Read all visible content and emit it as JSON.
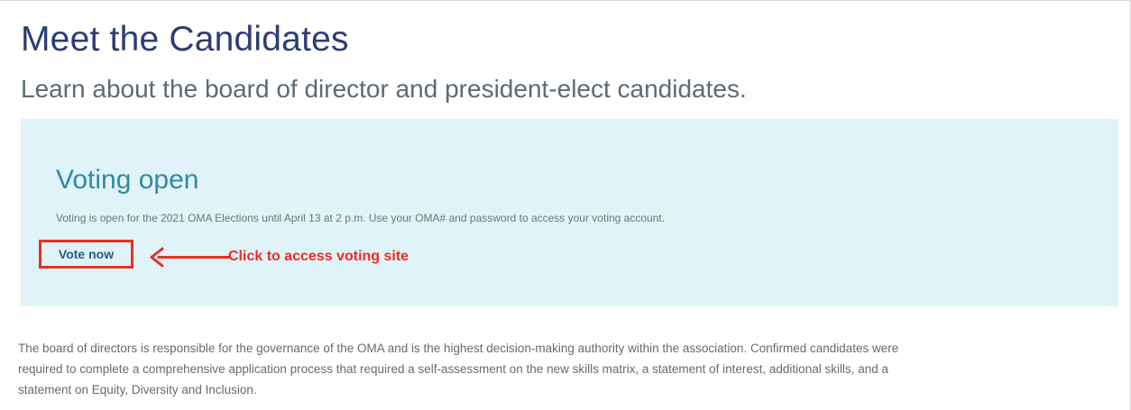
{
  "page": {
    "title": "Meet the Candidates",
    "subtitle": "Learn about the board of director and president-elect candidates."
  },
  "voting": {
    "heading": "Voting open",
    "message": "Voting is open for the 2021 OMA Elections until April 13 at 2 p.m. Use your OMA# and password to access your voting account.",
    "button_label": "Vote now",
    "annotation": "Click to access voting site",
    "arrow_icon": "left-arrow-icon"
  },
  "description": {
    "lines": [
      "The board of directors is responsible for the governance of the OMA and is the highest decision-making authority within the association. Confirmed candidates were",
      "required to complete a comprehensive application process that required a self-assessment on the new skills matrix, a statement of interest, additional skills, and a",
      "statement on Equity, Diversity and Inclusion."
    ]
  },
  "colors": {
    "title": "#2d3d73",
    "subtitle": "#5b6b75",
    "panel_background": "#dff3f8",
    "voting_heading": "#3289a3",
    "annotation_red": "#e53224",
    "button_text": "#245d84",
    "body_text": "#6a6a6a"
  }
}
